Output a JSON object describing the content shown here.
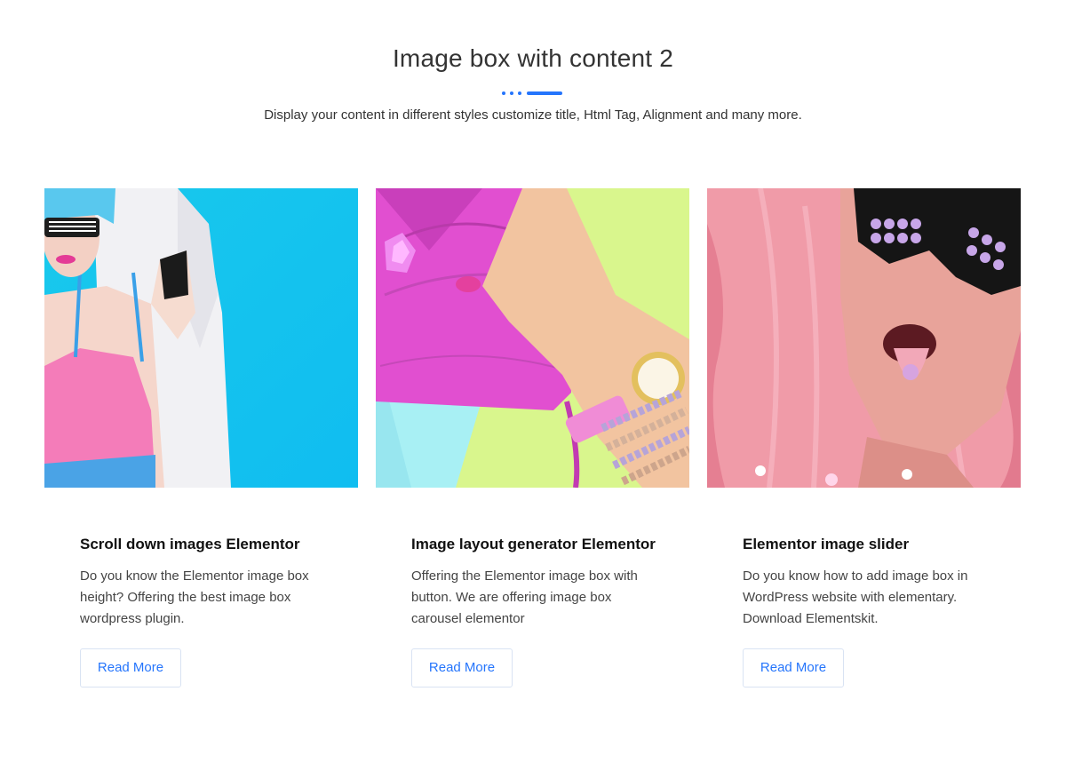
{
  "header": {
    "title": "Image box with content 2",
    "subtitle": "Display your content in different styles customize title, Html Tag, Alignment and many more.",
    "accent_color": "#2575fc"
  },
  "cards": [
    {
      "image": "woman-blue-wig-pink-swimsuit",
      "title": "Scroll down images Elementor",
      "text": "Do you know the Elementor image box height? Offering the best image box wordpress plugin.",
      "button": "Read More"
    },
    {
      "image": "pink-clutch-bag-hand-watch",
      "title": "Image layout generator Elementor",
      "text": "Offering the Elementor image box with button. We are offering image box carousel elementor",
      "button": "Read More"
    },
    {
      "image": "woman-pink-hair-sunglasses",
      "title": "Elementor image slider",
      "text": "Do you know how to add image box in WordPress website with elementary. Download Elementskit.",
      "button": "Read More"
    }
  ]
}
